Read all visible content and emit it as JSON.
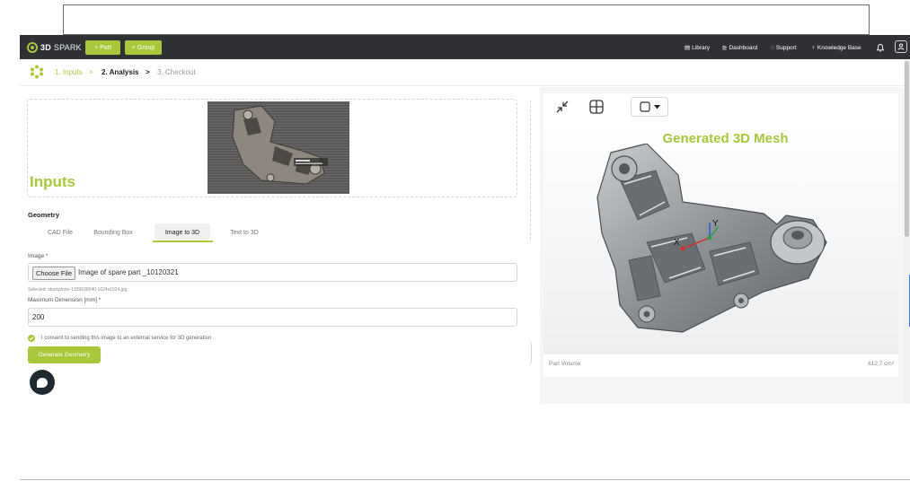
{
  "navbar": {
    "logo_bold": "3D",
    "logo_light": "SPARK",
    "part_button": "+ Part",
    "group_button": "+ Group",
    "links": [
      {
        "icon": "library-icon",
        "glyph": "▤",
        "label": "Library"
      },
      {
        "icon": "dashboard-icon",
        "glyph": "⊵",
        "label": "Dashboard"
      },
      {
        "icon": "support-icon",
        "glyph": "◌",
        "label": "Support"
      },
      {
        "icon": "knowledge-base-icon",
        "glyph": "♀",
        "label": "Knowledge Base"
      }
    ],
    "bell_icon": "bell-icon",
    "avatar_icon": "user-icon"
  },
  "breadcrumb": {
    "step1": "1. Inputs",
    "sep1": ">",
    "step2": "2. Analysis",
    "sep2": ">",
    "step3": "3. Checkout"
  },
  "inputs": {
    "title": "Inputs",
    "geometry_label": "Geometry",
    "tabs": [
      "CAD File",
      "Bounding Box",
      "Image to 3D",
      "Text to 3D"
    ],
    "active_tab": "Image to 3D",
    "image_label": "Image *",
    "choose_file": "Choose File",
    "file_name": "Image of spare part _10120321",
    "selected_text": "Selected: stockphoto-1339636040-1024x1024.jpg",
    "max_dim_label": "Maximum Dimension [mm] *",
    "max_dim_value": "200",
    "consent_text": "I consent to sending this image to an external service for 3D generation",
    "consent_checked": true,
    "generate_button": "Generate Geometry"
  },
  "viewer": {
    "mesh_title": "Generated 3D Mesh",
    "part_volume_label": "Part Volume",
    "part_volume_value": "612,7 cm³"
  },
  "colors": {
    "accent": "#a8c83a",
    "navbar": "#2f3134"
  }
}
